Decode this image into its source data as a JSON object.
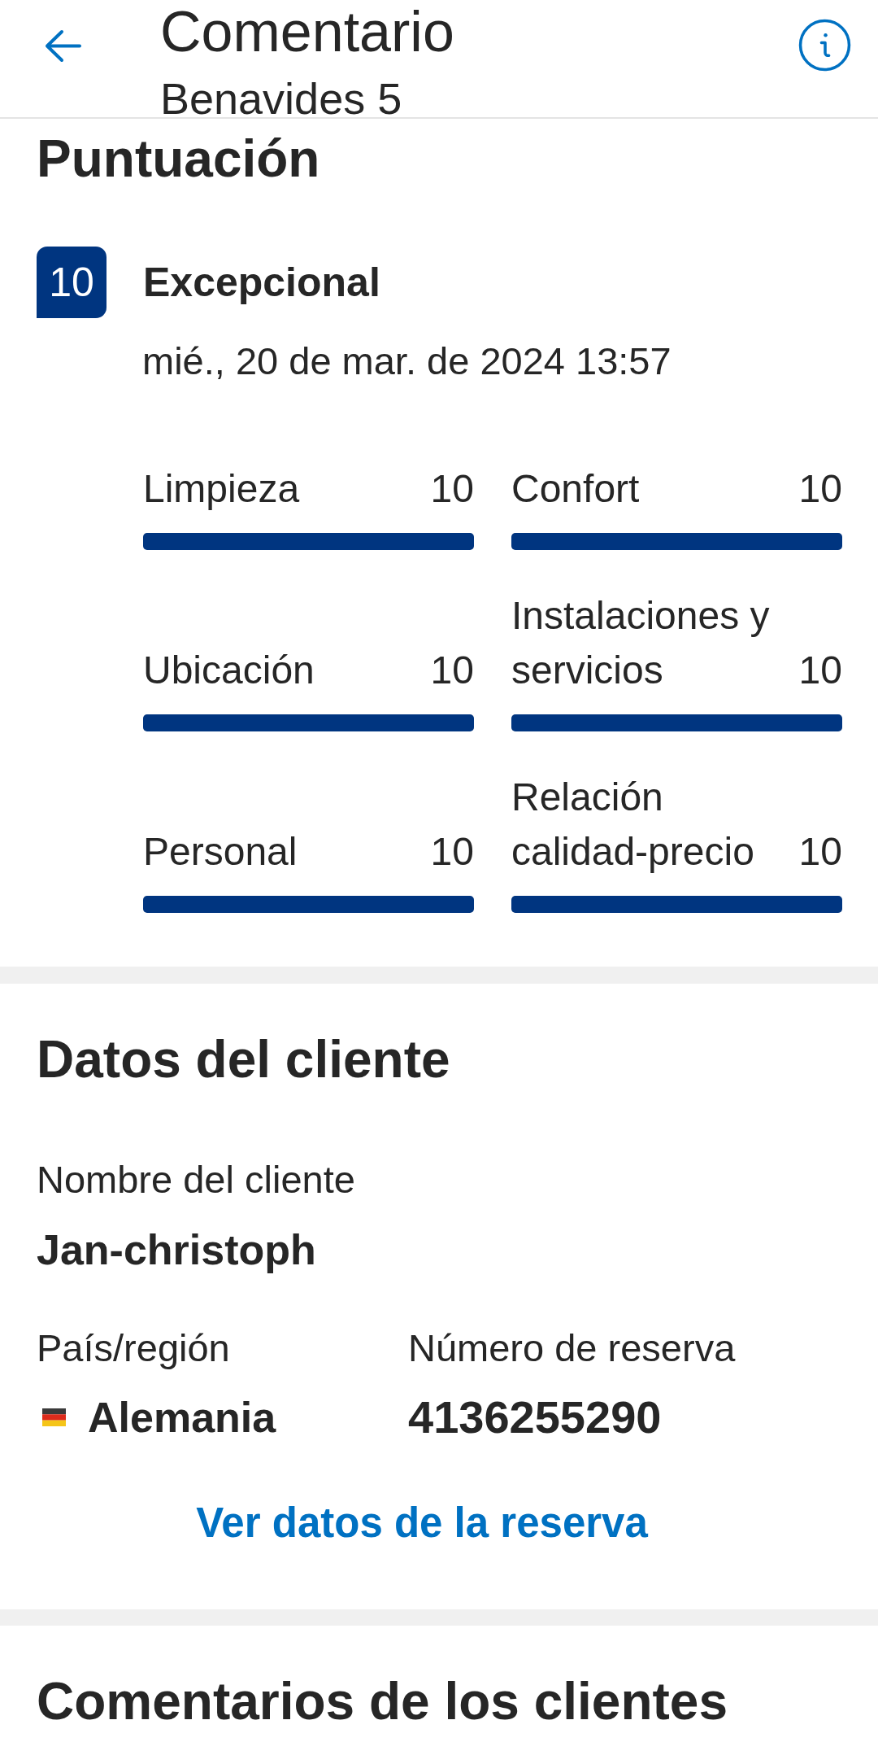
{
  "header": {
    "title": "Comentario",
    "subtitle": "Benavides 5"
  },
  "score": {
    "heading": "Puntuación",
    "value": "10",
    "label": "Excepcional",
    "date": "mié., 20 de mar. de 2024 13:57"
  },
  "categories": [
    {
      "label": "Limpieza",
      "score": "10",
      "level": 1
    },
    {
      "label": "Ubicación",
      "score": "10",
      "level": 1
    },
    {
      "label": "Personal",
      "score": "10",
      "level": 1
    },
    {
      "label": "Confort",
      "score": "10",
      "level": 1
    },
    {
      "label": "Instalaciones y servicios",
      "score": "10",
      "level": 1
    },
    {
      "label": "Relación calidad-precio",
      "score": "10",
      "level": 1
    }
  ],
  "guest": {
    "heading": "Datos del cliente",
    "name_label": "Nombre del cliente",
    "name": "Jan-christoph",
    "country_label": "País/región",
    "country": "Alemania",
    "reservation_label": "Número de reserva",
    "reservation": "4136255290",
    "link": "Ver datos de la reserva"
  },
  "reviews": {
    "heading": "Comentarios de los clientes"
  }
}
